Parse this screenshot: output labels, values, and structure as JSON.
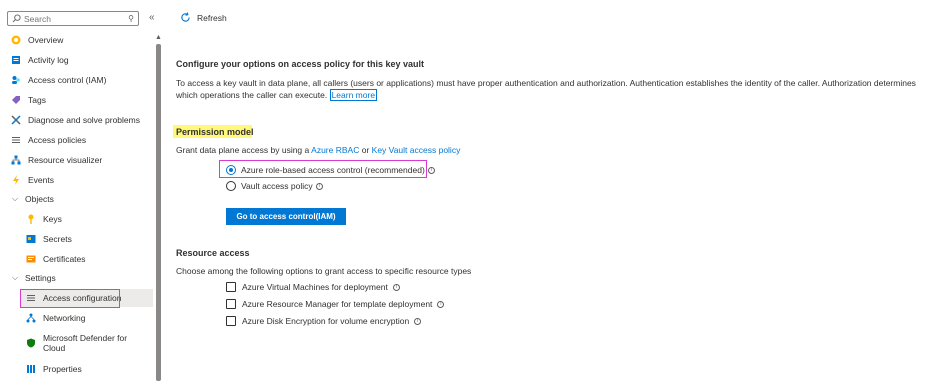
{
  "sidebar": {
    "search": {
      "placeholder": "Search",
      "value": ""
    },
    "items": [
      {
        "label": "Overview"
      },
      {
        "label": "Activity log"
      },
      {
        "label": "Access control (IAM)"
      },
      {
        "label": "Tags"
      },
      {
        "label": "Diagnose and solve problems"
      },
      {
        "label": "Access policies"
      },
      {
        "label": "Resource visualizer"
      },
      {
        "label": "Events"
      },
      {
        "label": "Objects"
      },
      {
        "label": "Keys"
      },
      {
        "label": "Secrets"
      },
      {
        "label": "Certificates"
      },
      {
        "label": "Settings"
      },
      {
        "label": "Access configuration"
      },
      {
        "label": "Networking"
      },
      {
        "label": "Microsoft Defender for",
        "label2": "Cloud"
      },
      {
        "label": "Properties"
      }
    ]
  },
  "toolbar": {
    "refresh_label": "Refresh"
  },
  "main": {
    "title": "Configure your options on access policy for this key vault",
    "description": "To access a key vault in data plane, all callers (users or applications) must have proper authentication and authorization. Authentication establishes the identity of the caller. Authorization determines which operations the caller can execute.",
    "learn_more": "Learn more",
    "permission_model": {
      "heading": "Permission model",
      "grant_prefix": "Grant data plane access by using a",
      "rbac_link": "Azure RBAC",
      "or": "or",
      "kv_link": "Key Vault access policy",
      "options": [
        {
          "label": "Azure role-based access control (recommended)",
          "selected": true
        },
        {
          "label": "Vault access policy",
          "selected": false
        }
      ],
      "button": "Go to access control(IAM)"
    },
    "resource_access": {
      "heading": "Resource access",
      "description": "Choose among the following options to grant access to specific resource types",
      "options": [
        {
          "label": "Azure Virtual Machines for deployment",
          "checked": false
        },
        {
          "label": "Azure Resource Manager for template deployment",
          "checked": false
        },
        {
          "label": "Azure Disk Encryption for volume encryption",
          "checked": false
        }
      ]
    }
  },
  "colors": {
    "accent": "#0078d4",
    "highlight": "#fff87a",
    "outline": "#d83bd2"
  }
}
